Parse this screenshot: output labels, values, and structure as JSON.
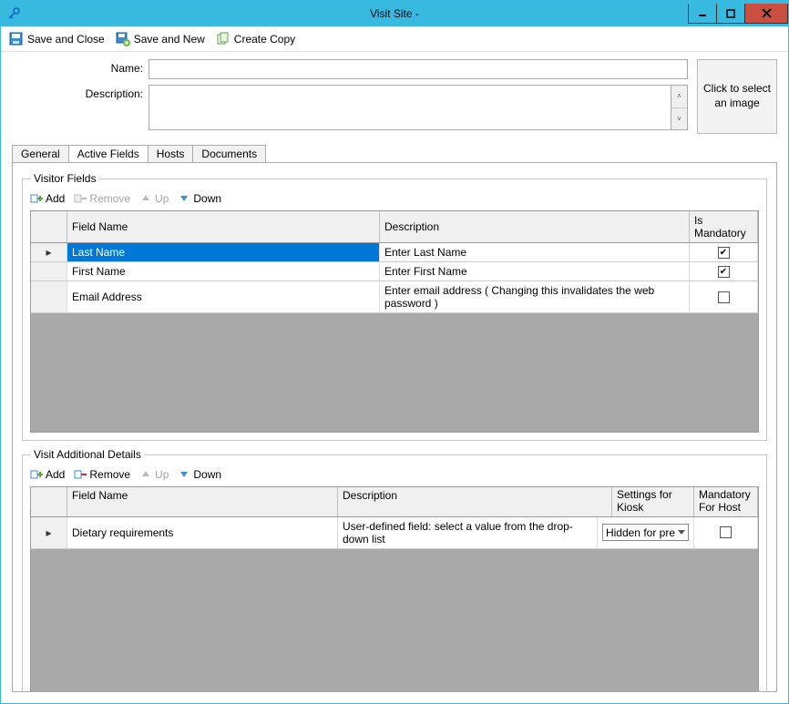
{
  "window": {
    "title": "Visit Site  -"
  },
  "toolbar": {
    "save_close": "Save and Close",
    "save_new": "Save and New",
    "create_copy": "Create Copy"
  },
  "form": {
    "name_label": "Name:",
    "name_value": "",
    "description_label": "Description:",
    "description_value": "",
    "image_picker": "Click to select an image"
  },
  "tabs": {
    "general": "General",
    "active_fields": "Active Fields",
    "hosts": "Hosts",
    "documents": "Documents"
  },
  "visitor_fields": {
    "legend": "Visitor Fields",
    "buttons": {
      "add": "Add",
      "remove": "Remove",
      "up": "Up",
      "down": "Down"
    },
    "columns": {
      "field_name": "Field Name",
      "description": "Description",
      "mandatory": "Is Mandatory"
    },
    "rows": [
      {
        "name": "Last Name",
        "description": "Enter Last Name",
        "mandatory": true,
        "selected": true
      },
      {
        "name": "First Name",
        "description": "Enter First Name",
        "mandatory": true,
        "selected": false
      },
      {
        "name": "Email Address",
        "description": "Enter email address ( Changing this invalidates the web password )",
        "mandatory": false,
        "selected": false
      }
    ]
  },
  "additional_details": {
    "legend": "Visit Additional Details",
    "buttons": {
      "add": "Add",
      "remove": "Remove",
      "up": "Up",
      "down": "Down"
    },
    "columns": {
      "field_name": "Field Name",
      "description": "Description",
      "kiosk": "Settings for Kiosk",
      "mhost": "Mandatory For Host"
    },
    "rows": [
      {
        "name": "Dietary requirements",
        "description": "User-defined field: select a value from the drop-down list",
        "kiosk": "Hidden for pre",
        "mhost": false
      }
    ]
  }
}
